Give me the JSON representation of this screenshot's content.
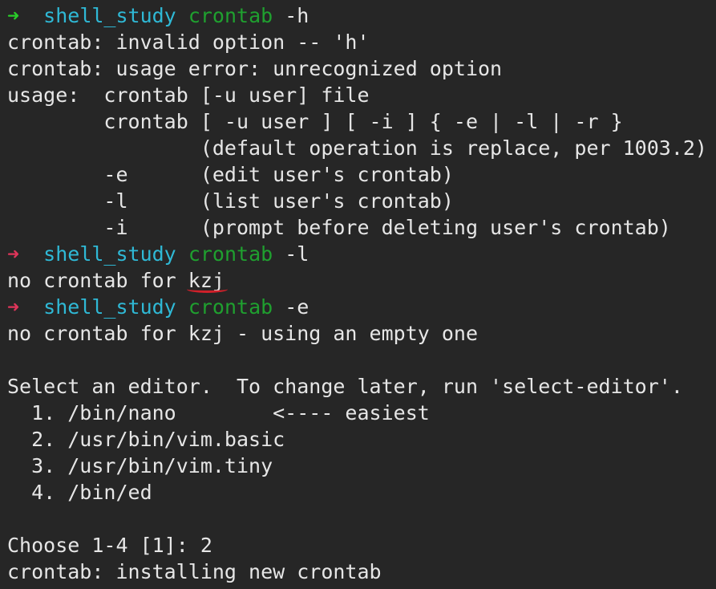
{
  "terminal": {
    "colors": {
      "background": "#262626",
      "text": "#e6e6e6",
      "prompt_arrow_ok": "#29cc29",
      "prompt_arrow_error": "#e0355a",
      "prompt_directory": "#2fb9d6",
      "command": "#1fa02f",
      "annotation_underline": "#d1202a"
    },
    "prompts": [
      {
        "arrow": "➜",
        "dir": "shell_study",
        "cmd": "crontab",
        "args": " -h"
      },
      {
        "arrow": "➜",
        "dir": "shell_study",
        "cmd": "crontab",
        "args": " -l"
      },
      {
        "arrow": "➜",
        "dir": "shell_study",
        "cmd": "crontab",
        "args": " -e"
      }
    ],
    "output_h": [
      "crontab: invalid option -- 'h'",
      "crontab: usage error: unrecognized option",
      "usage:  crontab [-u user] file",
      "        crontab [ -u user ] [ -i ] { -e | -l | -r }",
      "                (default operation is replace, per 1003.2)",
      "        -e      (edit user's crontab)",
      "        -l      (list user's crontab)",
      "        -i      (prompt before deleting user's crontab)"
    ],
    "output_l": {
      "prefix": "no crontab for ",
      "user": "kzj"
    },
    "output_e": [
      "no crontab for kzj - using an empty one",
      "",
      "Select an editor.  To change later, run 'select-editor'.",
      "  1. /bin/nano        <---- easiest",
      "  2. /usr/bin/vim.basic",
      "  3. /usr/bin/vim.tiny",
      "  4. /bin/ed",
      "",
      "Choose 1-4 [1]: 2",
      "crontab: installing new crontab"
    ]
  }
}
